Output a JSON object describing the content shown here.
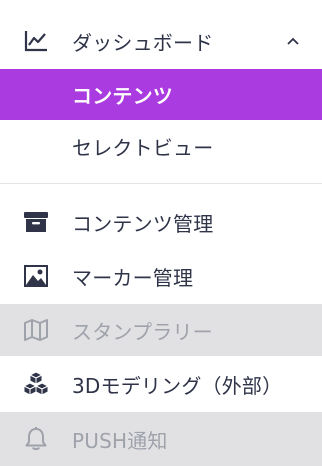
{
  "menu": {
    "dashboard": {
      "label": "ダッシュボード",
      "icon": "chart-line-icon",
      "expanded_icon": "chevron-up-icon"
    },
    "contents": {
      "label": "コンテンツ",
      "state": "selected"
    },
    "select_view": {
      "label": "セレクトビュー"
    },
    "contents_manage": {
      "label": "コンテンツ管理",
      "icon": "archive-box-icon"
    },
    "marker_manage": {
      "label": "マーカー管理",
      "icon": "image-icon"
    },
    "stamp_rally": {
      "label": "スタンプラリー",
      "icon": "map-icon",
      "state": "disabled"
    },
    "modeling_3d": {
      "label": "3Dモデリング（外部）",
      "icon": "cubes-icon"
    },
    "push": {
      "label": "PUSH通知",
      "icon": "bell-icon",
      "state": "disabled"
    }
  },
  "colors": {
    "accent": "#a93be0",
    "disabled_bg": "#e1e1e3",
    "text": "#2f3448",
    "disabled_text": "#9fa2ab"
  }
}
